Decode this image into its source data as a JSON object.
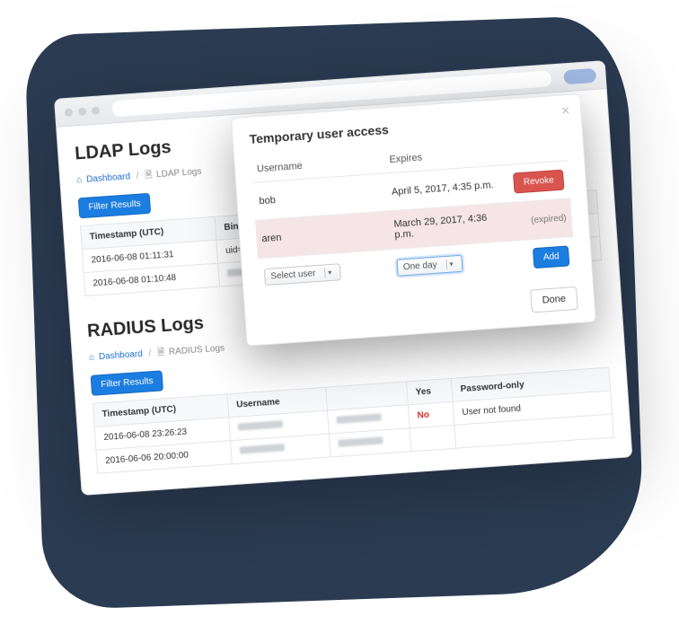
{
  "page": {
    "ldap": {
      "title": "LDAP Logs",
      "crumb_dashboard": "Dashboard",
      "crumb_current": "LDAP Logs",
      "filter_btn": "Filter Results",
      "col_timestamp": "Timestamp (UTC)",
      "col_binddn": "Bind_DN",
      "rows": [
        {
          "ts": "2016-06-08 01:11:31",
          "dn_prefix": "uid="
        },
        {
          "ts": "2016-06-08 01:10:48",
          "dn_prefix": ""
        }
      ]
    },
    "radius": {
      "title": "RADIUS Logs",
      "crumb_dashboard": "Dashboard",
      "crumb_current": "RADIUS Logs",
      "filter_btn": "Filter Results",
      "col_timestamp": "Timestamp (UTC)",
      "col_username": "Username",
      "col_ok": "Yes",
      "col_no": "No",
      "col_auth": "Password-only",
      "col_err": "User not found",
      "rows": [
        {
          "ts": "2016-06-08 23:26:23"
        },
        {
          "ts": "2016-06-06 20:00:00"
        }
      ]
    }
  },
  "modal": {
    "title": "Temporary user access",
    "col_user": "Username",
    "col_expires": "Expires",
    "rows": [
      {
        "user": "bob",
        "expires": "April 5, 2017, 4:35 p.m."
      },
      {
        "user": "aren",
        "expires": "March 29, 2017, 4:36 p.m."
      }
    ],
    "revoke_btn": "Revoke",
    "expired_label": "(expired)",
    "select_user": "Select user",
    "select_duration": "One day",
    "add_btn": "Add",
    "done_btn": "Done"
  }
}
